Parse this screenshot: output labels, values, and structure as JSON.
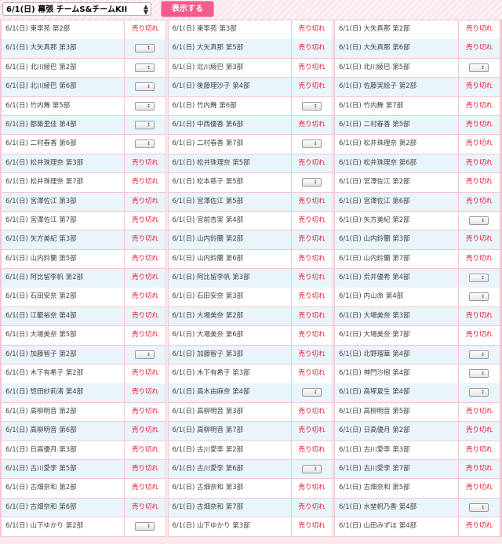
{
  "header": {
    "event_select_value": "6/1(日) 幕張 チームS&チームKII",
    "show_button_label": "表示する"
  },
  "sold_out_label": "売り切れ",
  "columns": [
    [
      {
        "name": "6/1(日) 東李苑 第2部",
        "status": "sold"
      },
      {
        "name": "6/1(日) 大矢真那 第3部",
        "status": "select"
      },
      {
        "name": "6/1(日) 北川綾巴 第2部",
        "status": "select"
      },
      {
        "name": "6/1(日) 北川綾巴 第6部",
        "status": "select"
      },
      {
        "name": "6/1(日) 竹内舞 第5部",
        "status": "select"
      },
      {
        "name": "6/1(日) 都築里佳 第4部",
        "status": "select"
      },
      {
        "name": "6/1(日) 二村春香 第6部",
        "status": "select"
      },
      {
        "name": "6/1(日) 松井珠理奈 第3部",
        "status": "sold"
      },
      {
        "name": "6/1(日) 松井珠理奈 第7部",
        "status": "sold"
      },
      {
        "name": "6/1(日) 宮澤佐江 第3部",
        "status": "sold"
      },
      {
        "name": "6/1(日) 宮澤佐江 第7部",
        "status": "sold"
      },
      {
        "name": "6/1(日) 矢方美紀 第3部",
        "status": "sold"
      },
      {
        "name": "6/1(日) 山内鈴蘭 第5部",
        "status": "sold"
      },
      {
        "name": "6/1(日) 阿比留李帆 第2部",
        "status": "sold"
      },
      {
        "name": "6/1(日) 石田安奈 第2部",
        "status": "sold"
      },
      {
        "name": "6/1(日) 江籠裕奈 第4部",
        "status": "sold"
      },
      {
        "name": "6/1(日) 大場美奈 第5部",
        "status": "sold"
      },
      {
        "name": "6/1(日) 加藤智子 第2部",
        "status": "select"
      },
      {
        "name": "6/1(日) 木下有希子 第2部",
        "status": "sold"
      },
      {
        "name": "6/1(日) 惣田紗莉渚 第4部",
        "status": "sold"
      },
      {
        "name": "6/1(日) 高柳明音 第2部",
        "status": "sold"
      },
      {
        "name": "6/1(日) 高柳明音 第6部",
        "status": "sold"
      },
      {
        "name": "6/1(日) 日高優月 第3部",
        "status": "sold"
      },
      {
        "name": "6/1(日) 古川愛李 第5部",
        "status": "sold"
      },
      {
        "name": "6/1(日) 古畑奈和 第2部",
        "status": "sold"
      },
      {
        "name": "6/1(日) 古畑奈和 第6部",
        "status": "sold"
      },
      {
        "name": "6/1(日) 山下ゆかり 第2部",
        "status": "select"
      }
    ],
    [
      {
        "name": "6/1(日) 東李苑 第3部",
        "status": "sold"
      },
      {
        "name": "6/1(日) 大矢真那 第5部",
        "status": "sold"
      },
      {
        "name": "6/1(日) 北川綾巴 第3部",
        "status": "sold"
      },
      {
        "name": "6/1(日) 後藤理沙子 第4部",
        "status": "sold"
      },
      {
        "name": "6/1(日) 竹内舞 第6部",
        "status": "select"
      },
      {
        "name": "6/1(日) 中西優香 第6部",
        "status": "sold"
      },
      {
        "name": "6/1(日) 二村春香 第7部",
        "status": "select"
      },
      {
        "name": "6/1(日) 松井珠理奈 第5部",
        "status": "sold"
      },
      {
        "name": "6/1(日) 松本慈子 第5部",
        "status": "select"
      },
      {
        "name": "6/1(日) 宮澤佐江 第5部",
        "status": "sold"
      },
      {
        "name": "6/1(日) 宮前杏実 第4部",
        "status": "sold"
      },
      {
        "name": "6/1(日) 山内鈴蘭 第2部",
        "status": "sold"
      },
      {
        "name": "6/1(日) 山内鈴蘭 第6部",
        "status": "sold"
      },
      {
        "name": "6/1(日) 阿比留李帆 第3部",
        "status": "sold"
      },
      {
        "name": "6/1(日) 石田安奈 第3部",
        "status": "sold"
      },
      {
        "name": "6/1(日) 大場美奈 第2部",
        "status": "sold"
      },
      {
        "name": "6/1(日) 大場美奈 第6部",
        "status": "sold"
      },
      {
        "name": "6/1(日) 加藤智子 第3部",
        "status": "sold"
      },
      {
        "name": "6/1(日) 木下有希子 第3部",
        "status": "sold"
      },
      {
        "name": "6/1(日) 高木由麻奈 第4部",
        "status": "select"
      },
      {
        "name": "6/1(日) 高柳明音 第3部",
        "status": "sold"
      },
      {
        "name": "6/1(日) 高柳明音 第7部",
        "status": "sold"
      },
      {
        "name": "6/1(日) 古川愛李 第2部",
        "status": "sold"
      },
      {
        "name": "6/1(日) 古川愛李 第6部",
        "status": "select"
      },
      {
        "name": "6/1(日) 古畑奈和 第3部",
        "status": "sold"
      },
      {
        "name": "6/1(日) 古畑奈和 第7部",
        "status": "sold"
      },
      {
        "name": "6/1(日) 山下ゆかり 第3部",
        "status": "sold"
      }
    ],
    [
      {
        "name": "6/1(日) 大矢真那 第2部",
        "status": "sold"
      },
      {
        "name": "6/1(日) 大矢真那 第6部",
        "status": "sold"
      },
      {
        "name": "6/1(日) 北川綾巴 第5部",
        "status": "select"
      },
      {
        "name": "6/1(日) 佐藤実絵子 第2部",
        "status": "sold"
      },
      {
        "name": "6/1(日) 竹内舞 第7部",
        "status": "sold"
      },
      {
        "name": "6/1(日) 二村春香 第5部",
        "status": "sold"
      },
      {
        "name": "6/1(日) 松井珠理奈 第2部",
        "status": "sold"
      },
      {
        "name": "6/1(日) 松井珠理奈 第6部",
        "status": "sold"
      },
      {
        "name": "6/1(日) 宮澤佐江 第2部",
        "status": "sold"
      },
      {
        "name": "6/1(日) 宮澤佐江 第6部",
        "status": "sold"
      },
      {
        "name": "6/1(日) 矢方美紀 第2部",
        "status": "select"
      },
      {
        "name": "6/1(日) 山内鈴蘭 第3部",
        "status": "sold"
      },
      {
        "name": "6/1(日) 山内鈴蘭 第7部",
        "status": "sold"
      },
      {
        "name": "6/1(日) 荒井優希 第4部",
        "status": "select"
      },
      {
        "name": "6/1(日) 内山命 第4部",
        "status": "select"
      },
      {
        "name": "6/1(日) 大場美奈 第3部",
        "status": "sold"
      },
      {
        "name": "6/1(日) 大場美奈 第7部",
        "status": "sold"
      },
      {
        "name": "6/1(日) 北野瑠華 第4部",
        "status": "select"
      },
      {
        "name": "6/1(日) 神門沙樹 第4部",
        "status": "select"
      },
      {
        "name": "6/1(日) 高塚夏生 第4部",
        "status": "select"
      },
      {
        "name": "6/1(日) 高柳明音 第5部",
        "status": "sold"
      },
      {
        "name": "6/1(日) 日高優月 第2部",
        "status": "sold"
      },
      {
        "name": "6/1(日) 古川愛李 第3部",
        "status": "sold"
      },
      {
        "name": "6/1(日) 古川愛李 第7部",
        "status": "sold"
      },
      {
        "name": "6/1(日) 古畑奈和 第5部",
        "status": "sold"
      },
      {
        "name": "6/1(日) 水埜帆乃香 第4部",
        "status": "select"
      },
      {
        "name": "6/1(日) 山田みずほ 第4部",
        "status": "sold"
      }
    ]
  ]
}
